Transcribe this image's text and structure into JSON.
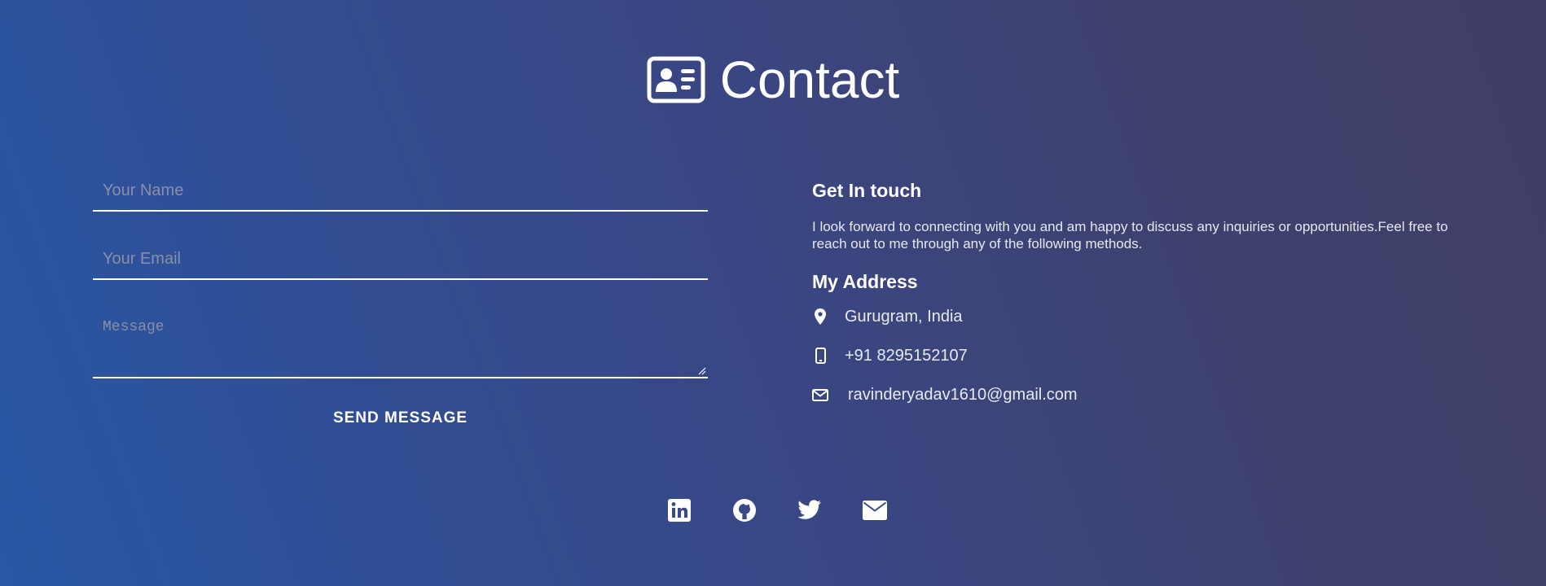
{
  "header": {
    "title": "Contact",
    "icon": "contact-card-icon"
  },
  "form": {
    "name_placeholder": "Your Name",
    "email_placeholder": "Your Email",
    "message_placeholder": "Message",
    "send_label": "SEND MESSAGE"
  },
  "info": {
    "heading": "Get In touch",
    "intro": "I look forward to connecting with you and am happy to discuss any inquiries or opportunities.Feel free to reach out to me through any of the following methods.",
    "address_heading": "My Address",
    "items": [
      {
        "icon": "location-pin-icon",
        "text": "Gurugram, India"
      },
      {
        "icon": "mobile-phone-icon",
        "text": "+91 8295152107"
      },
      {
        "icon": "envelope-icon",
        "text": "ravinderyadav1610@gmail.com"
      }
    ]
  },
  "socials": [
    {
      "icon": "linkedin-icon"
    },
    {
      "icon": "github-icon"
    },
    {
      "icon": "twitter-icon"
    },
    {
      "icon": "mail-icon"
    }
  ],
  "colors": {
    "gradient_start": "#2858a6",
    "gradient_end": "#403e66",
    "text": "#ffffff",
    "placeholder": "#8a8fa8"
  }
}
